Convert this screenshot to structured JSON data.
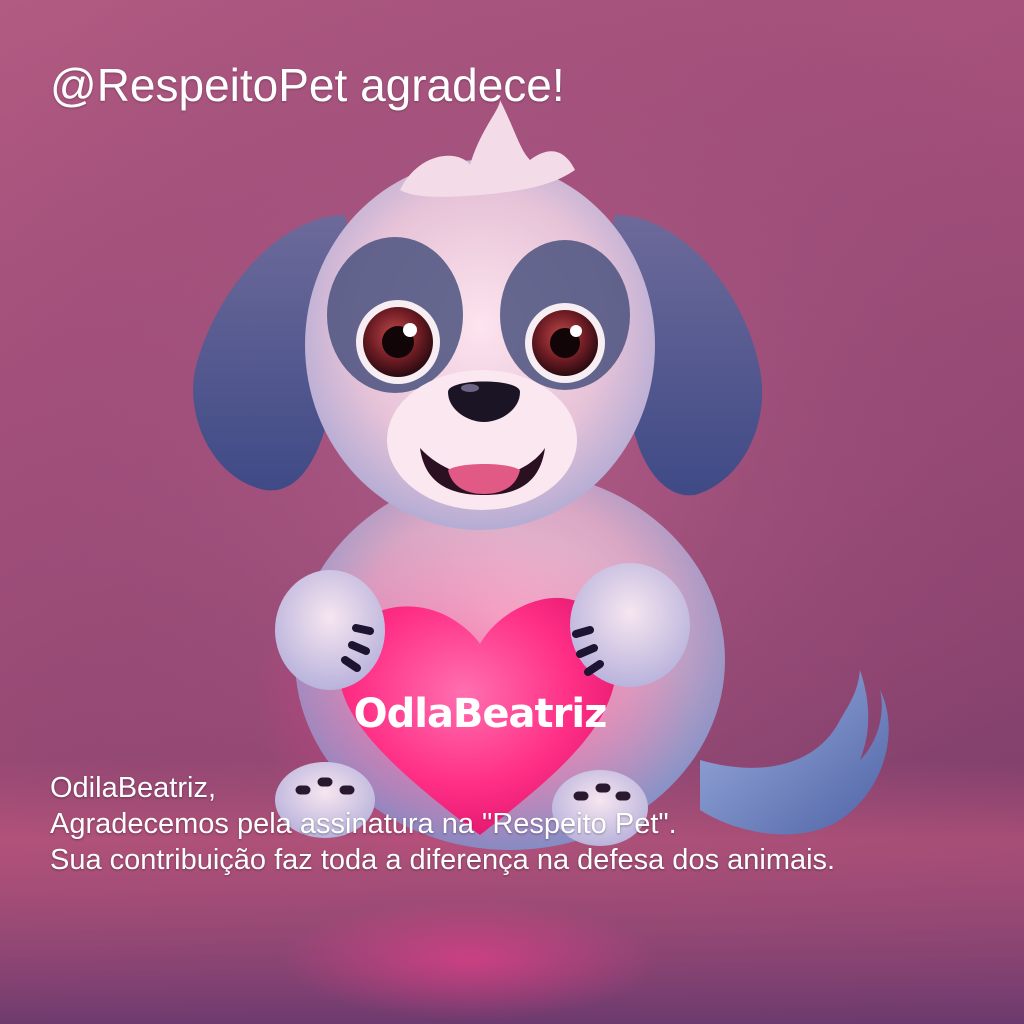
{
  "overlay": {
    "title": "@RespeitoPet agradece!"
  },
  "heart": {
    "label": "OdlaBeatriz",
    "color": "#ff2f86"
  },
  "message": {
    "line1": "OdilaBeatriz,",
    "line2": "Agradecemos pela assinatura na \"Respeito Pet\".",
    "line3": "Sua contribuição faz toda a diferença na defesa dos animais."
  },
  "colors": {
    "background": "#a24f7a",
    "text": "#ffffff"
  }
}
